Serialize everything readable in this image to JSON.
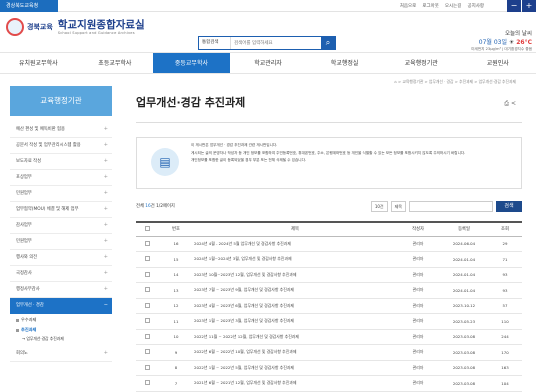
{
  "topbar": {
    "tag": "경상북도교육청",
    "links": [
      "처음으로",
      "로그아웃",
      "오시는길",
      "공지사항"
    ]
  },
  "header": {
    "office": "경북교육",
    "site_title": "학교지원종합자료실",
    "site_subtitle": "School Support and Guidance Archives",
    "search_select": "통합검색",
    "search_placeholder": "검색어를 입력하세요",
    "weather_label": "오늘의 날씨",
    "weather_date": "07월 03일",
    "weather_temp": "26°C",
    "weather_detail": "미세먼지 23μg/m³ | 대기환경지수 좋음"
  },
  "gnb": [
    "유치원교무학사",
    "초등교무학사",
    "중등교무학사",
    "학교관리자",
    "학교행정실",
    "교육행정기관",
    "교원인사"
  ],
  "gnb_active": 2,
  "lnb": {
    "title": "교육행정기관",
    "items": [
      "예산 편성 및 예독비판 협용",
      "공문서 작성 및 업무관리시스템 활용",
      "보도자료 작성",
      "포상업무",
      "민원업무",
      "업무협약(MOU) 체결 및 해제 업무",
      "감사업무",
      "민원업무",
      "행사와 의전",
      "국정감사",
      "행정사무감사"
    ],
    "active": "업무개선 · 경감",
    "subs": [
      "우수과제",
      "추진과제"
    ],
    "subsub": "→ 업무개선·경감 추진과제",
    "last": "회의노"
  },
  "content": {
    "breadcrumb": "⌂ > 교육행정기관 > 업무개선 · 경감 > 추진과제 > 업무개선·경감 추진과제",
    "title": "업무개선·경감 추진과제",
    "notice": [
      "이 게시판은 업무개선 · 경감 추진과제 관련 게시판입니다.",
      "게시되는 글의 운영자나 작성자 등 개인 정보를 포함하여 주민등록번호, 휴대폰번호, 주소, 은행계좌번호 등 개인을 식별할 수 있는 모든 정보를 포함시키지 않도록 주의하시기 바랍니다.",
      "개인정보를 포함한 글이 등록되었을 경우 부분 또는 전체 삭제될 수 있습니다."
    ],
    "count_label": "전체",
    "count": "16",
    "count_unit": "건",
    "page_info": "1/2페이지",
    "per_page": "10건",
    "search_field": "제목",
    "search_btn": "검색",
    "columns": [
      "",
      "번호",
      "제목",
      "작성자",
      "등록일",
      "조회"
    ],
    "rows": [
      {
        "no": "16",
        "title": "2024년 4월 - 2024년 5월 업무개선 및 경감사항 추진과제",
        "author": "관리자",
        "date": "2024.06.04",
        "views": "29"
      },
      {
        "no": "15",
        "title": "2024년 1월~2024년 3월, 업무개선 및 경감사항 추진과제",
        "author": "관리자",
        "date": "2024.01.04",
        "views": "71"
      },
      {
        "no": "14",
        "title": "2023년 10월~2023년 12월, 업무개선 및 경감사항 추진과제",
        "author": "관리자",
        "date": "2024.01.04",
        "views": "93"
      },
      {
        "no": "13",
        "title": "2023년 7월 ~ 2023년 9월, 업무개선 및 경감사항 추진과제",
        "author": "관리자",
        "date": "2024.01.04",
        "views": "93"
      },
      {
        "no": "12",
        "title": "2023년 4월 ~ 2023년 6월, 업무개선 및 경감사항 추진과제",
        "author": "관리자",
        "date": "2023.10.12",
        "views": "57"
      },
      {
        "no": "11",
        "title": "2023년 1월 ~ 2023년 3월, 업무개선 및 경감사항 추진과제",
        "author": "관리자",
        "date": "2023.05.23",
        "views": "110"
      },
      {
        "no": "10",
        "title": "2022년 11월 ~ 2022년 12월, 업무개선 및 경감사항 추진과제",
        "author": "관리자",
        "date": "2023.03.08",
        "views": "244"
      },
      {
        "no": "9",
        "title": "2022년 6월 ~ 2022년 10월, 업무개선 및 경감사항 추진과제",
        "author": "관리자",
        "date": "2023.03.08",
        "views": "170"
      },
      {
        "no": "8",
        "title": "2022년 1월 ~ 2022년 5월, 업무개선 및 경감사항 추진과제",
        "author": "관리자",
        "date": "2023.03.08",
        "views": "163"
      },
      {
        "no": "7",
        "title": "2021년 6월 ~ 2021년 12월, 업무개선 및 경감사항 추진과제",
        "author": "관리자",
        "date": "2023.03.08",
        "views": "104"
      }
    ]
  }
}
